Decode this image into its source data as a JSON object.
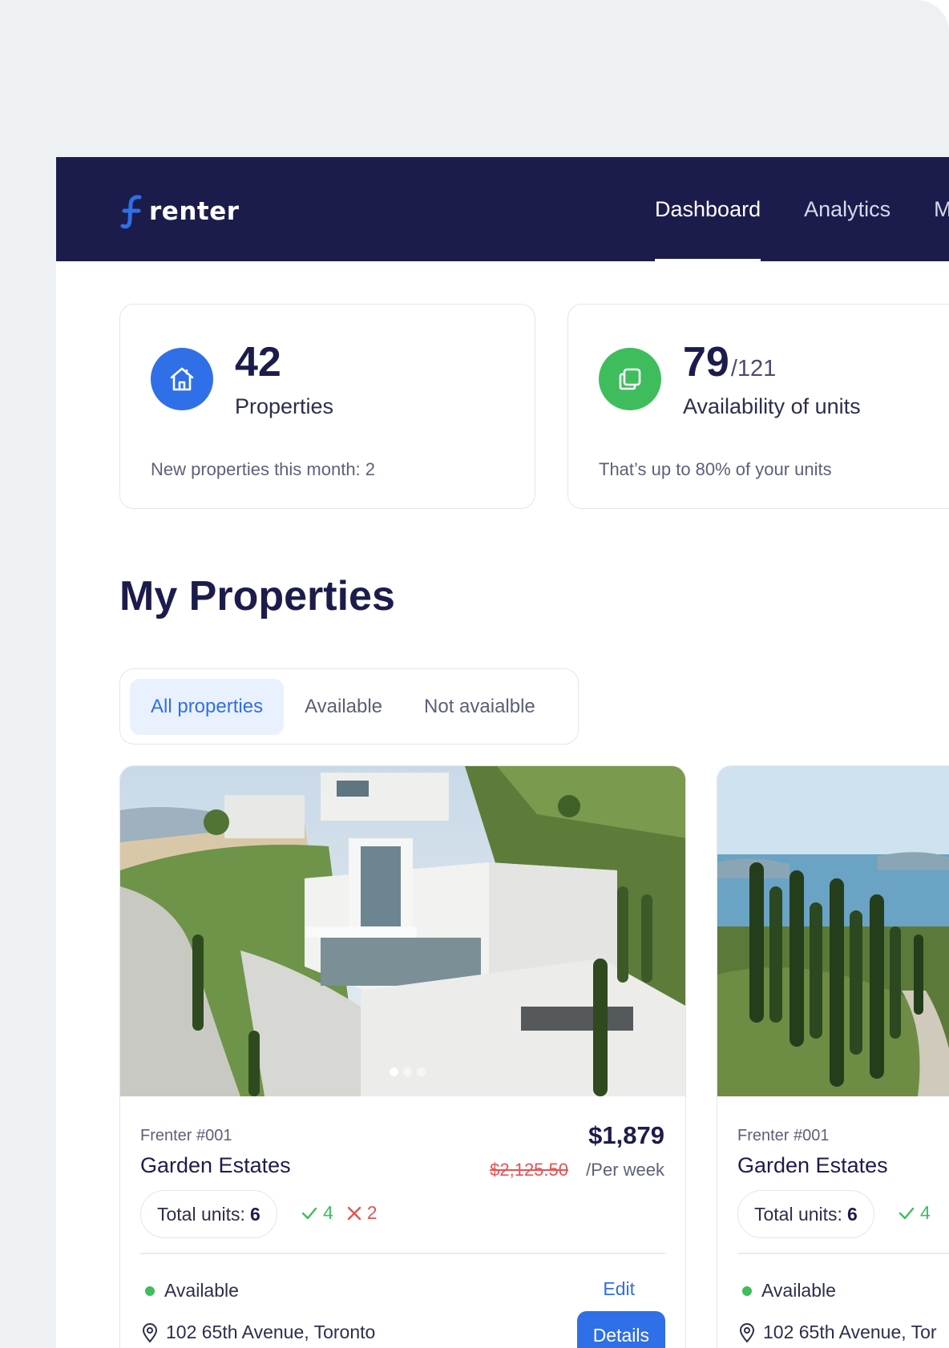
{
  "brand": {
    "name": "renter"
  },
  "nav": {
    "items": [
      {
        "label": "Dashboard",
        "active": true
      },
      {
        "label": "Analytics",
        "active": false
      },
      {
        "label": "M",
        "active": false
      }
    ]
  },
  "stats": [
    {
      "value": "42",
      "sub": "",
      "label": "Properties",
      "foot": "New properties this month: 2",
      "icon": "house-icon",
      "color": "#2f6fe8"
    },
    {
      "value": "79",
      "sub": "/121",
      "label": "Availability of units",
      "foot": "That’s up to 80% of your units",
      "icon": "copy-icon",
      "color": "#3fbd5c"
    }
  ],
  "section": {
    "title": "My Properties"
  },
  "filters": [
    {
      "label": "All properties",
      "active": true
    },
    {
      "label": "Available",
      "active": false
    },
    {
      "label": "Not avaialble",
      "active": false
    }
  ],
  "properties": [
    {
      "code": "Frenter #001",
      "name": "Garden Estates",
      "price": "$1,879",
      "old_price": "$2,125.50",
      "period": "/Per week",
      "units_label": "Total units:",
      "units_total": "6",
      "available": "4",
      "unavailable": "2",
      "status": "Available",
      "edit": "Edit",
      "address": "102 65th Avenue, Toronto",
      "details": "Details"
    },
    {
      "code": "Frenter #001",
      "name": "Garden Estates",
      "units_label": "Total units:",
      "units_total": "6",
      "available": "4",
      "status": "Available",
      "address": "102 65th Avenue, Tor"
    }
  ],
  "colors": {
    "navy": "#1c1c4c",
    "accent": "#2f6fe8",
    "success": "#3fbd5c",
    "danger": "#e65353"
  }
}
